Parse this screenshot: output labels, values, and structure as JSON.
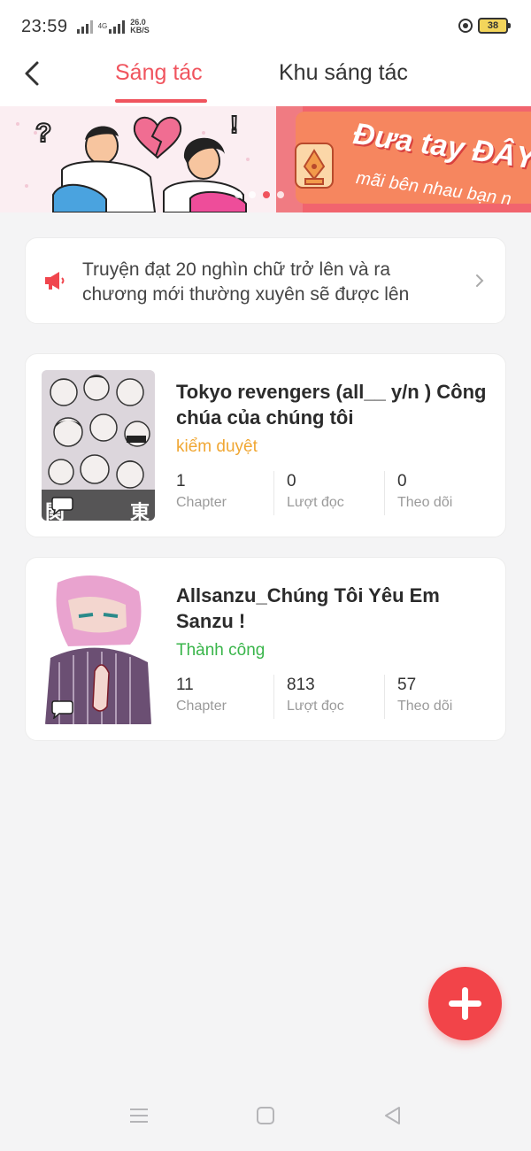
{
  "status_bar": {
    "time": "23:59",
    "network": "4G",
    "speed_value": "26.0",
    "speed_unit": "KB/S",
    "battery": "38"
  },
  "header": {
    "tabs": [
      {
        "label": "Sáng tác",
        "active": true
      },
      {
        "label": "Khu sáng tác",
        "active": false
      }
    ],
    "back_icon": "chevron-left-icon"
  },
  "banner": {
    "title": "Đưa tay ĐÂY",
    "subtitle": "mãi bên nhau bạn n",
    "slide_count": 4,
    "active_slide": 3
  },
  "notice": {
    "text": "Truyện đạt 20 nghìn chữ trở lên và ra chương mới thường xuyên sẽ được lên",
    "icon": "megaphone-icon"
  },
  "stories": [
    {
      "title": "Tokyo revengers (all__ y/n ) Công chúa của chúng tôi",
      "status": "kiểm duyệt",
      "stats": [
        {
          "value": "1",
          "label": "Chapter"
        },
        {
          "value": "0",
          "label": "Lượt đọc"
        },
        {
          "value": "0",
          "label": "Theo dõi"
        }
      ]
    },
    {
      "title": "Allsanzu_Chúng Tôi Yêu Em Sanzu !",
      "status": "Thành công",
      "stats": [
        {
          "value": "11",
          "label": "Chapter"
        },
        {
          "value": "813",
          "label": "Lượt đọc"
        },
        {
          "value": "57",
          "label": "Theo dõi"
        }
      ]
    }
  ],
  "fab": {
    "icon": "plus-icon"
  },
  "colors": {
    "accent": "#f0545e",
    "pending": "#f0a733",
    "success": "#39b54a",
    "fab": "#f24449"
  }
}
